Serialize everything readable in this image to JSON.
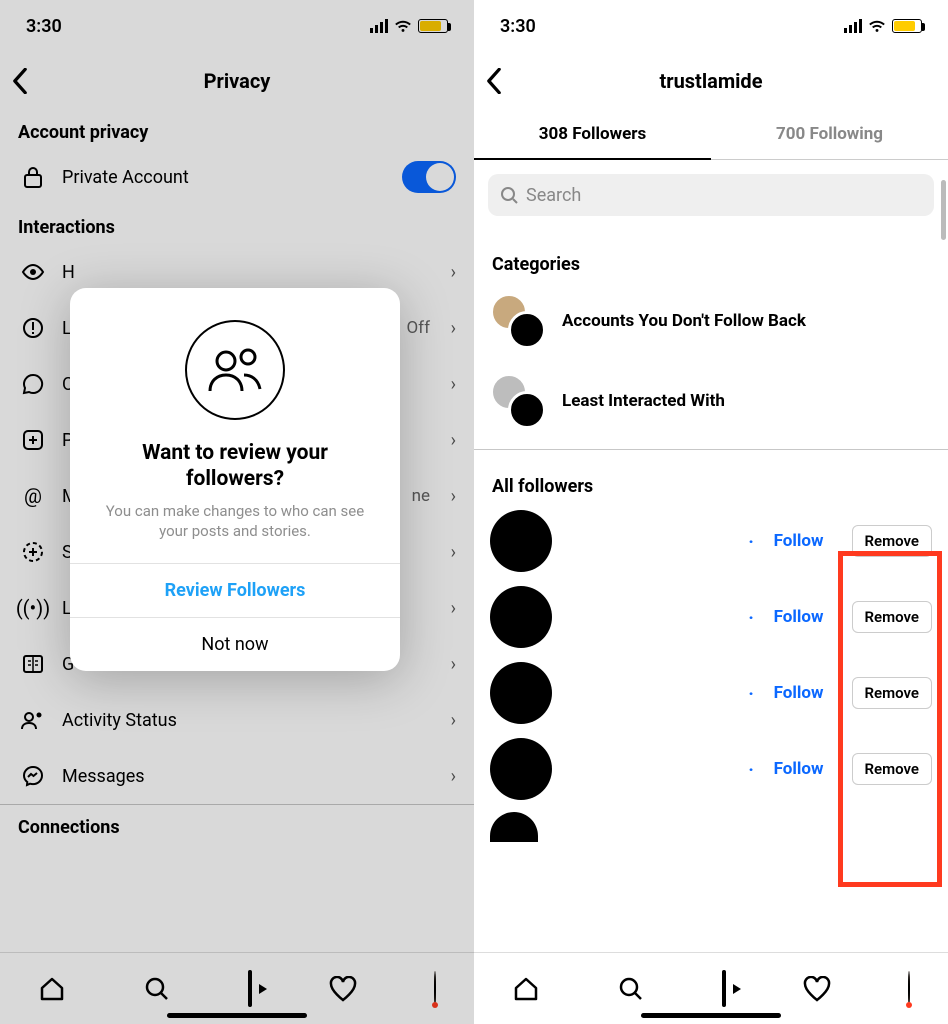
{
  "status": {
    "time": "3:30"
  },
  "left": {
    "title": "Privacy",
    "sectionAccount": "Account privacy",
    "privateAccount": "Private Account",
    "sectionInteractions": "Interactions",
    "rows": {
      "hidden": {
        "label": "H",
        "value": ""
      },
      "limits": {
        "label": "L",
        "value": "Off"
      },
      "comments": {
        "label": "C",
        "value": ""
      },
      "posts": {
        "label": "P",
        "value": ""
      },
      "mentions": {
        "label": "M",
        "value": "ne"
      },
      "story": {
        "label": "S",
        "value": ""
      },
      "live": {
        "label": "L",
        "value": ""
      },
      "guides": {
        "label": "G",
        "value": ""
      },
      "activity": {
        "label": "Activity Status",
        "value": ""
      },
      "messages": {
        "label": "Messages",
        "value": ""
      }
    },
    "sectionConnections": "Connections",
    "modal": {
      "title": "Want to review your followers?",
      "body": "You can make changes to who can see your posts and stories.",
      "primary": "Review Followers",
      "secondary": "Not now"
    }
  },
  "right": {
    "title": "trustlamide",
    "tabFollowers": "308 Followers",
    "tabFollowing": "700 Following",
    "searchPlaceholder": "Search",
    "categoriesHeader": "Categories",
    "cat1": "Accounts You Don't Follow Back",
    "cat2": "Least Interacted With",
    "allHeader": "All followers",
    "followLabel": "Follow",
    "removeLabel": "Remove"
  }
}
